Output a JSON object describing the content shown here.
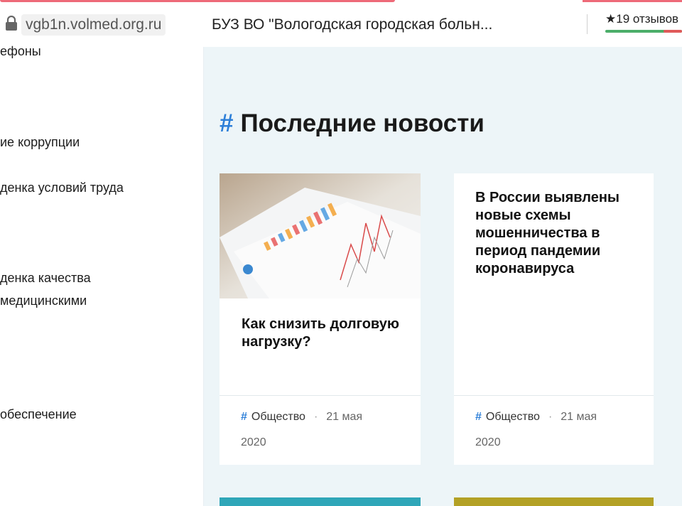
{
  "browser": {
    "url": "vgb1n.volmed.org.ru",
    "site_title": "БУЗ ВО \"Вологодская городская больн...",
    "reviews": "★19 отзывов"
  },
  "sidebar": {
    "items": [
      {
        "label": "ефоны"
      },
      {
        "label": "ие коррупции"
      },
      {
        "label": "денка условий труда"
      },
      {
        "label": "денка качества"
      },
      {
        "label": "медицинскими"
      },
      {
        "label": "обеспечение"
      }
    ]
  },
  "main": {
    "heading_hash": "#",
    "heading": "Последние новости",
    "cards": [
      {
        "title": "Как снизить долговую нагрузку?",
        "category": "Общество",
        "date": "21 мая",
        "year": "2020"
      },
      {
        "title": "В России выявлены новые схемы мошенничества в период пандемии коронавируса",
        "category": "Общество",
        "date": "21 мая",
        "year": "2020"
      }
    ]
  },
  "colors": {
    "accent": "#2d7fd8",
    "background": "#edf5f8",
    "top_line": "#ee6a78"
  },
  "icons": {
    "lock": "lock-icon",
    "star": "star-icon",
    "hash": "hash-icon"
  }
}
